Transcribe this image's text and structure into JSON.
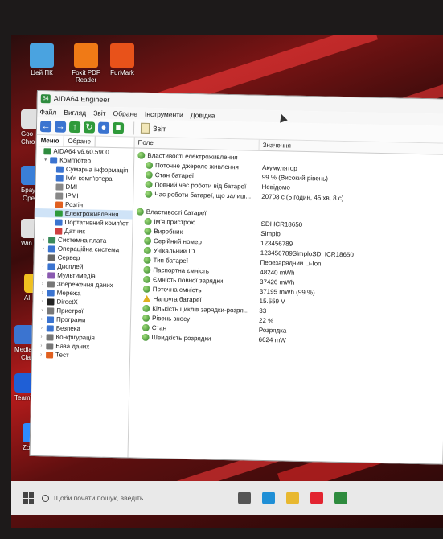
{
  "desktop": {
    "icons": [
      {
        "label": "Цей ПК",
        "icon": "computer-icon",
        "color": "#4aa3e0"
      },
      {
        "label": "Foxit PDF Reader",
        "icon": "foxit-pdf-icon",
        "color": "#f07a16"
      },
      {
        "label": "FurMark",
        "icon": "furmark-icon",
        "color": "#e8521a"
      }
    ],
    "side_labels": [
      "Goo",
      "Chro",
      "Брау",
      "Ope",
      "Win",
      "Al",
      "Media",
      "Clas",
      "TeamV",
      "Zoom"
    ]
  },
  "window": {
    "title": "AIDA64 Engineer",
    "app_badge": "64",
    "menu": [
      "Файл",
      "Вигляд",
      "Звіт",
      "Обране",
      "Інструменти",
      "Довідка"
    ],
    "toolbar": {
      "report_label": "Звіт"
    },
    "left_tabs": [
      "Меню",
      "Обране"
    ],
    "tree": [
      {
        "label": "AIDA64 v6.60.5900",
        "level": 0,
        "color": "#2e8b3e",
        "twisty": ""
      },
      {
        "label": "Комп'ютер",
        "level": 1,
        "color": "#3b74d0",
        "twisty": "v"
      },
      {
        "label": "Сумарна інформація",
        "level": 2,
        "color": "#3b74d0",
        "twisty": ""
      },
      {
        "label": "Ім'я комп'ютера",
        "level": 2,
        "color": "#3b74d0",
        "twisty": ""
      },
      {
        "label": "DMI",
        "level": 2,
        "color": "#888888",
        "twisty": ""
      },
      {
        "label": "IPMI",
        "level": 2,
        "color": "#888888",
        "twisty": ""
      },
      {
        "label": "Розгін",
        "level": 2,
        "color": "#e06020",
        "twisty": ""
      },
      {
        "label": "Електроживлення",
        "level": 2,
        "color": "#2f9a3a",
        "twisty": "",
        "selected": true
      },
      {
        "label": "Портативний комп'ют",
        "level": 2,
        "color": "#3b74d0",
        "twisty": ""
      },
      {
        "label": "Датчик",
        "level": 2,
        "color": "#d04040",
        "twisty": ""
      },
      {
        "label": "Системна плата",
        "level": 1,
        "color": "#3a8a5a",
        "twisty": ">"
      },
      {
        "label": "Операційна система",
        "level": 1,
        "color": "#3b74d0",
        "twisty": ">"
      },
      {
        "label": "Сервер",
        "level": 1,
        "color": "#666666",
        "twisty": ">"
      },
      {
        "label": "Дисплей",
        "level": 1,
        "color": "#3b74d0",
        "twisty": ">"
      },
      {
        "label": "Мультимедіа",
        "level": 1,
        "color": "#8a5ab0",
        "twisty": ">"
      },
      {
        "label": "Збереження даних",
        "level": 1,
        "color": "#777777",
        "twisty": ">"
      },
      {
        "label": "Мережа",
        "level": 1,
        "color": "#3b74d0",
        "twisty": ">"
      },
      {
        "label": "DirectX",
        "level": 1,
        "color": "#222222",
        "twisty": ">"
      },
      {
        "label": "Пристрої",
        "level": 1,
        "color": "#777777",
        "twisty": ">"
      },
      {
        "label": "Програми",
        "level": 1,
        "color": "#3b74d0",
        "twisty": ">"
      },
      {
        "label": "Безпека",
        "level": 1,
        "color": "#3b74d0",
        "twisty": ">"
      },
      {
        "label": "Конфігурація",
        "level": 1,
        "color": "#777777",
        "twisty": ">"
      },
      {
        "label": "База даних",
        "level": 1,
        "color": "#777777",
        "twisty": ">"
      },
      {
        "label": "Тест",
        "level": 1,
        "color": "#e06020",
        "twisty": ">"
      }
    ],
    "columns": {
      "field": "Поле",
      "value": "Значення"
    },
    "sections": [
      {
        "title": "Властивості електроживлення",
        "rows": [
          {
            "field": "Поточне джерело живлення",
            "value": "Акумулятор"
          },
          {
            "field": "Стан батареї",
            "value": "99 % (Високий рівень)"
          },
          {
            "field": "Повний час роботи від батареї",
            "value": "Невідомо"
          },
          {
            "field": "Час роботи батареї, що залиш...",
            "value": "20708 с (5 годин, 45 хв, 8 с)"
          }
        ]
      },
      {
        "title": "Властивості батареї",
        "rows": [
          {
            "field": "Ім'я пристрою",
            "value": "SDI ICR18650"
          },
          {
            "field": "Виробник",
            "value": "Simplo"
          },
          {
            "field": "Серійний номер",
            "value": "123456789"
          },
          {
            "field": "Унікальний ID",
            "value": "123456789SimploSDI ICR18650"
          },
          {
            "field": "Тип батареї",
            "value": "Перезарядний Li-Ion"
          },
          {
            "field": "Паспортна ємність",
            "value": "48240 mWh"
          },
          {
            "field": "Ємність повної зарядки",
            "value": "37426 mWh"
          },
          {
            "field": "Поточна ємність",
            "value": "37195 mWh (99 %)"
          },
          {
            "field": "Напруга батареї",
            "value": "15.559 V",
            "warn": true
          },
          {
            "field": "Кількість циклів зарядки-розря...",
            "value": "33"
          },
          {
            "field": "Рівень зносу",
            "value": "22 %"
          },
          {
            "field": "Стан",
            "value": "Розрядка"
          },
          {
            "field": "Швидкість розрядки",
            "value": "6624 mW"
          }
        ]
      }
    ]
  },
  "taskbar": {
    "search_placeholder": "Щоби почати пошук, введіть",
    "apps": [
      {
        "icon": "task-view-icon",
        "color": "#555555"
      },
      {
        "icon": "edge-icon",
        "color": "#1f8fd6"
      },
      {
        "icon": "file-explorer-icon",
        "color": "#e8b830"
      },
      {
        "icon": "opera-icon",
        "color": "#e22430"
      },
      {
        "icon": "aida64-icon",
        "color": "#2e8b3e"
      }
    ]
  }
}
